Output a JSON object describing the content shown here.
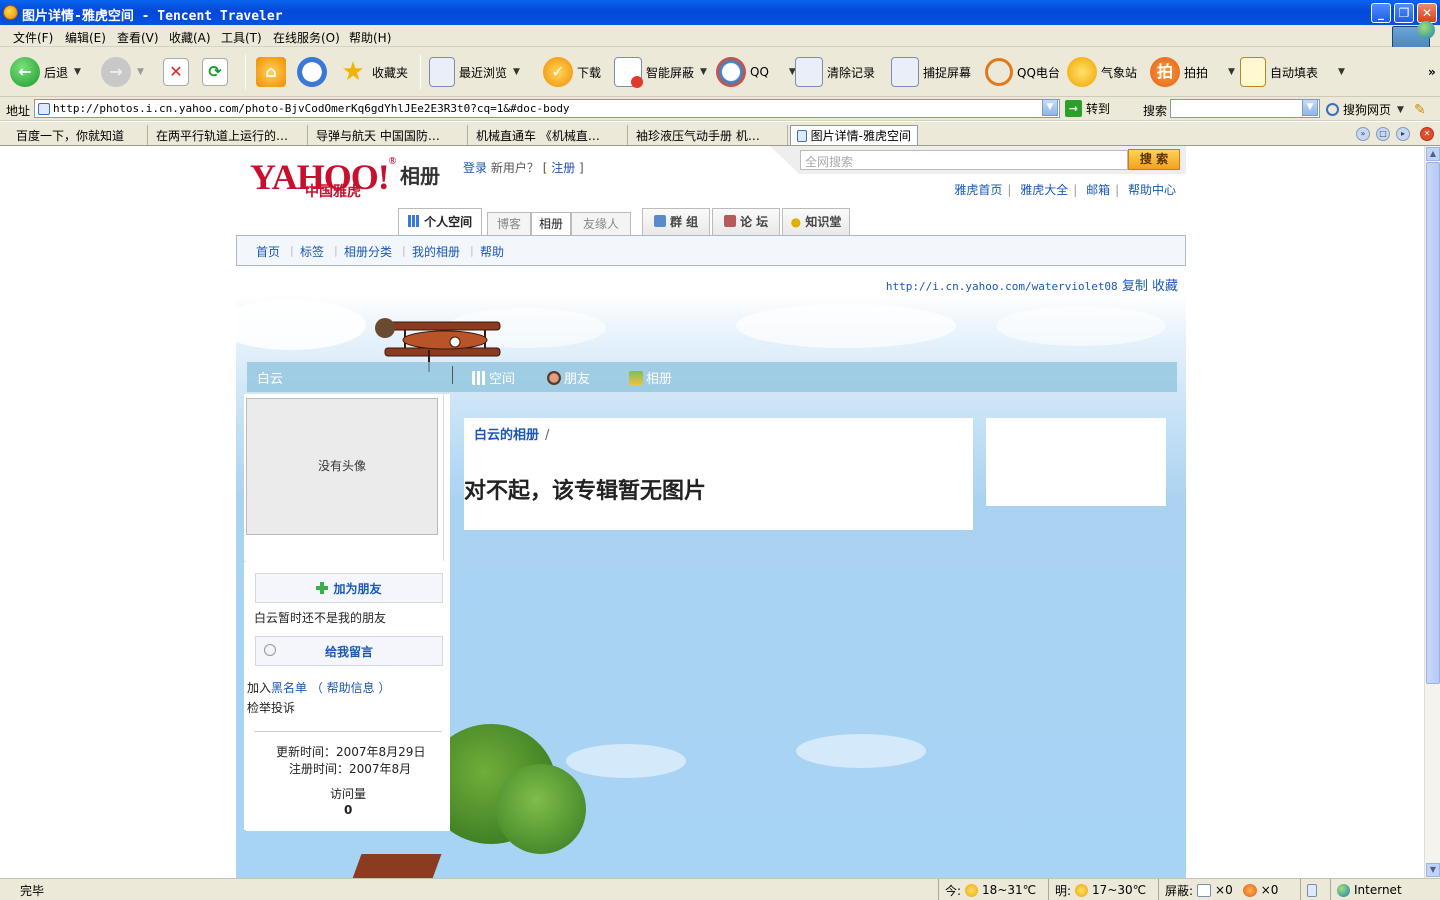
{
  "window": {
    "title": "图片详情-雅虎空间 - Tencent Traveler",
    "controls": {
      "minimize": "_",
      "restore": "❐",
      "close": "✕"
    }
  },
  "menu": [
    "文件(F)",
    "编辑(E)",
    "查看(V)",
    "收藏(A)",
    "工具(T)",
    "在线服务(O)",
    "帮助(H)"
  ],
  "toolbar": {
    "back": "后退",
    "favorites": "收藏夹",
    "recent": "最近浏览",
    "download": "下载",
    "smart_block": "智能屏蔽",
    "qq": "QQ",
    "clear": "清除记录",
    "capture": "捕捉屏幕",
    "radio": "QQ电台",
    "weather": "气象站",
    "paipai": "拍拍",
    "paipai_glyph": "拍",
    "autofill": "自动填表",
    "more": "»"
  },
  "address": {
    "label": "地址",
    "url": "http://photos.i.cn.yahoo.com/photo-BjvCodOmerKq6gdYhlJEe2E3R3t0?cq=1&#doc-body",
    "go": "转到",
    "go_glyph": "→",
    "search_label": "搜索",
    "engine": "搜狗网页"
  },
  "tabs": [
    {
      "label": "百度一下，你就知道"
    },
    {
      "label": "在两平行轨道上运行的…"
    },
    {
      "label": "导弹与航天 中国国防…"
    },
    {
      "label": "机械直通车 《机械直…"
    },
    {
      "label": "袖珍液压气动手册 机…"
    },
    {
      "label": "图片详情-雅虎空间"
    }
  ],
  "yahoo": {
    "logo": "YAHOO!",
    "logo_mark": "®",
    "logo_sub": "中国雅虎",
    "product": "相册",
    "login": "登录",
    "new_user": "新用户？",
    "bracket_open": "[",
    "bracket_close": "]",
    "register": "注册",
    "search_placeholder": "全网搜索",
    "search_button": "搜 索",
    "top_links": [
      "雅虎首页",
      "雅虎大全",
      "邮箱",
      "帮助中心"
    ],
    "tabs": {
      "personal": "个人空间",
      "blog": "博客",
      "album": "相册",
      "friends": "友缘人",
      "groups": "群 组",
      "forum": "论 坛",
      "knowledge": "知识堂"
    },
    "nav": [
      "首页",
      "标签",
      "相册分类",
      "我的相册",
      "帮助"
    ],
    "space_url": "http://i.cn.yahoo.com/waterviolet08",
    "copy": "复制",
    "collect": "收藏"
  },
  "space": {
    "owner": "白云",
    "nav": [
      "空间",
      "朋友",
      "相册"
    ],
    "avatar_placeholder": "没有头像",
    "add_friend": "加为朋友",
    "not_friend": "白云暂时还不是我的朋友",
    "leave_message": "给我留言",
    "blacklist_prefix": "加入",
    "blacklist": "黑名单",
    "help_info": "（ 帮助信息 ）",
    "report": "检举投诉",
    "updated": "更新时间：2007年8月29日",
    "registered": "注册时间：2007年8月",
    "visits_label": "访问量",
    "visits": "0",
    "album_link": "白云的相册",
    "crumb_sep": "/",
    "empty_message": "对不起，该专辑暂无图片"
  },
  "status": {
    "text": "完毕",
    "today_label": "今:",
    "today_temp": "18~31℃",
    "tomorrow_label": "明:",
    "tomorrow_temp": "17~30℃",
    "block_label": "屏蔽:",
    "block1": "×0",
    "block2": "×0",
    "zone": "Internet"
  },
  "colors": {
    "link": "#1b57b5",
    "xp_title": "#0a5ae8",
    "yahoo_red": "#c8102e",
    "sky": "#a7d3f4"
  }
}
